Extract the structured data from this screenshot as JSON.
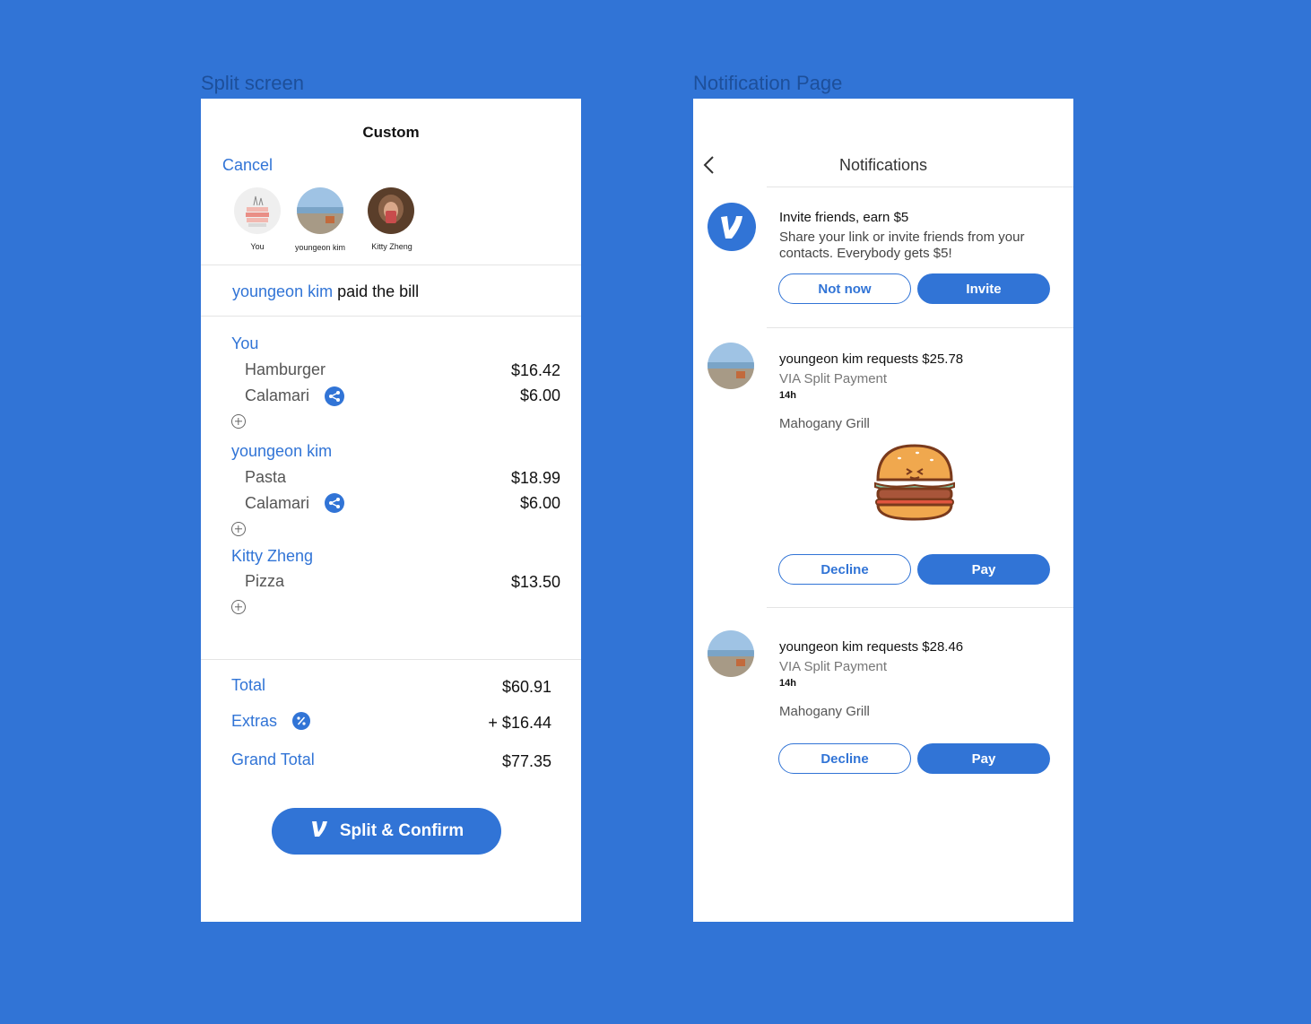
{
  "labels": {
    "split_frame": "Split screen",
    "notification_frame": "Notification Page"
  },
  "split": {
    "title": "Custom",
    "cancel": "Cancel",
    "avatars": [
      {
        "name": "You"
      },
      {
        "name": "youngeon kim"
      },
      {
        "name": "Kitty Zheng"
      }
    ],
    "payer_name": "youngeon kim",
    "payer_suffix": " paid the bill",
    "groups": [
      {
        "person": "You",
        "items": [
          {
            "name": "Hamburger",
            "price": "$16.42"
          },
          {
            "name": "Calamari",
            "price": "$6.00",
            "shared": true
          }
        ]
      },
      {
        "person": "youngeon kim",
        "items": [
          {
            "name": "Pasta",
            "price": "$18.99"
          },
          {
            "name": "Calamari",
            "price": "$6.00",
            "shared": true
          }
        ]
      },
      {
        "person": "Kitty Zheng",
        "items": [
          {
            "name": "Pizza",
            "price": "$13.50"
          }
        ]
      }
    ],
    "totals": {
      "total_label": "Total",
      "total_value": "$60.91",
      "extras_label": "Extras",
      "extras_value": "+ $16.44",
      "grand_label": "Grand Total",
      "grand_value": "$77.35"
    },
    "confirm_label": "Split & Confirm"
  },
  "notifications": {
    "title": "Notifications",
    "invite": {
      "title": "Invite friends, earn $5",
      "body_line1": "Share your link or invite friends from your",
      "body_line2": "contacts. Everybody gets $5!",
      "secondary": "Not now",
      "primary": "Invite"
    },
    "requests": [
      {
        "title": "youngeon kim requests $25.78",
        "via": "VIA Split Payment",
        "time": "14h",
        "merchant": "Mahogany Grill",
        "decline": "Decline",
        "pay": "Pay"
      },
      {
        "title": "youngeon kim requests $28.46",
        "via": "VIA Split Payment",
        "time": "14h",
        "merchant": "Mahogany Grill",
        "decline": "Decline",
        "pay": "Pay"
      }
    ]
  },
  "colors": {
    "background": "#3174d6",
    "accent": "#3174d6"
  }
}
